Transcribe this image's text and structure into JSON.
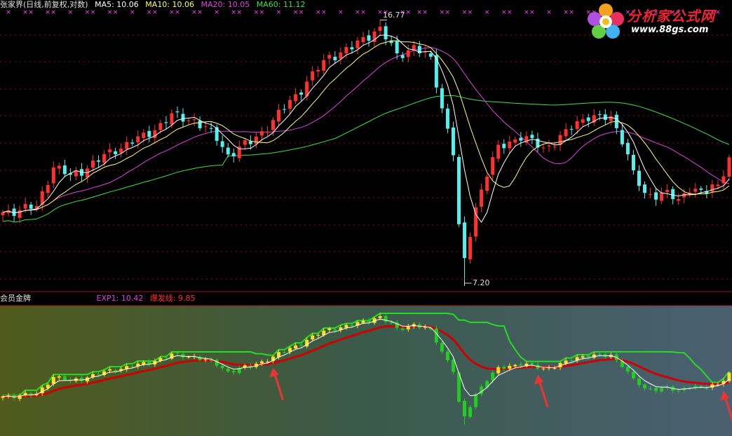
{
  "legend": {
    "title": "张家界(日线,前复权,对数)",
    "ma5_label": "MA5: 10.06",
    "ma10_label": "MA10: 10.06",
    "ma20_label": "MA20: 10.05",
    "ma60_label": "MA60: 11.12"
  },
  "sub_legend": {
    "title": "会员金牌",
    "exp1_label": "EXP1: 10.42",
    "burst_label": "爆发线: 9.85"
  },
  "annotations": {
    "peak_price": "16.77",
    "low_price": "7.20"
  },
  "logo": {
    "title": "分析家公式网",
    "url": "www.88gs.com"
  },
  "colors": {
    "up_candle": "#ff3030",
    "down_candle": "#54f0f0",
    "ma5": "#ffffff",
    "ma10": "#ffff80",
    "ma20": "#e040e0",
    "ma60": "#40e040",
    "exp1": "#ffffff",
    "burst_line": "#cc0000",
    "stop_line": "#22dd22",
    "sub_up": "#ffe020",
    "sub_down": "#22cc22",
    "arrow": "#ee3333",
    "marker_x": "#ff40ff"
  },
  "chart_data": {
    "type": "candlestick",
    "price_scale": "log",
    "ylim": [
      7.0,
      17.3
    ],
    "count": 130,
    "peak": {
      "index": 67,
      "value": 16.77
    },
    "trough": {
      "index": 82,
      "value": 7.2
    },
    "key_prices": [
      [
        0,
        8.95
      ],
      [
        6,
        9.1
      ],
      [
        9,
        10.4
      ],
      [
        12,
        10.05
      ],
      [
        17,
        10.6
      ],
      [
        20,
        11.0
      ],
      [
        25,
        11.45
      ],
      [
        30,
        12.25
      ],
      [
        34,
        12.1
      ],
      [
        38,
        11.4
      ],
      [
        40,
        10.8
      ],
      [
        44,
        11.25
      ],
      [
        48,
        12.05
      ],
      [
        53,
        13.4
      ],
      [
        58,
        14.9
      ],
      [
        62,
        15.3
      ],
      [
        66,
        16.2
      ],
      [
        67,
        16.3
      ],
      [
        70,
        14.9
      ],
      [
        73,
        15.4
      ],
      [
        76,
        14.7
      ],
      [
        78,
        12.6
      ],
      [
        80,
        10.9
      ],
      [
        81,
        8.5
      ],
      [
        82,
        7.6
      ],
      [
        84,
        9.1
      ],
      [
        86,
        10.2
      ],
      [
        88,
        11.0
      ],
      [
        92,
        11.5
      ],
      [
        96,
        11.0
      ],
      [
        100,
        11.6
      ],
      [
        104,
        12.3
      ],
      [
        108,
        12.1
      ],
      [
        110,
        11.4
      ],
      [
        112,
        10.2
      ],
      [
        114,
        9.4
      ],
      [
        116,
        9.5
      ],
      [
        118,
        9.6
      ],
      [
        120,
        9.2
      ],
      [
        122,
        9.7
      ],
      [
        125,
        9.6
      ],
      [
        127,
        9.7
      ],
      [
        129,
        10.7
      ]
    ],
    "ma5_last": 10.06,
    "ma10_last": 10.06,
    "ma20_last": 10.05,
    "ma60_last": 11.12,
    "exp1_last": 10.42,
    "burst_last": 9.85,
    "signal_arrows": [
      48,
      95,
      128
    ]
  }
}
